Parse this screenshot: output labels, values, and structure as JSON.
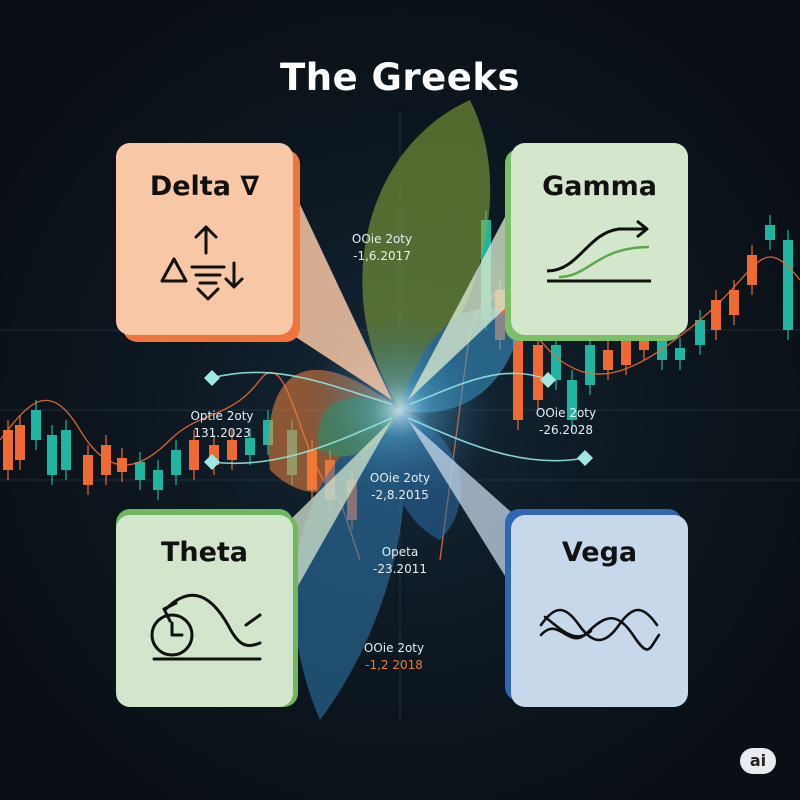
{
  "title": "The Greeks",
  "cards": {
    "delta": {
      "name": "Delta ∇",
      "icon": "delta-arrows-icon"
    },
    "gamma": {
      "name": "Gamma",
      "icon": "gamma-curve-icon"
    },
    "theta": {
      "name": "Theta",
      "icon": "clock-decay-icon"
    },
    "vega": {
      "name": "Vega",
      "icon": "volatility-waves-icon"
    }
  },
  "labels": [
    {
      "line1": "OOie 2oty",
      "line2": "-1,6.2017"
    },
    {
      "line1": "Optie 2oty",
      "line2": "131.2023"
    },
    {
      "line1": "OOie 2oty",
      "line2": "-26.2028"
    },
    {
      "line1": "OOie 2oty",
      "line2": "-2,8.2015"
    },
    {
      "line1": "Opeta",
      "line2": "-23.2011"
    },
    {
      "line1": "OOie 2oty",
      "line2": "-1,2 2018"
    }
  ],
  "badge": "ai",
  "colors": {
    "background": "#0b1017",
    "candle_up": "#1fb5a0",
    "candle_down": "#ef6a32",
    "delta_accent": "#f0753a",
    "gamma_accent": "#7bbf66",
    "theta_accent": "#6fb85e",
    "vega_accent": "#2f67b1"
  }
}
